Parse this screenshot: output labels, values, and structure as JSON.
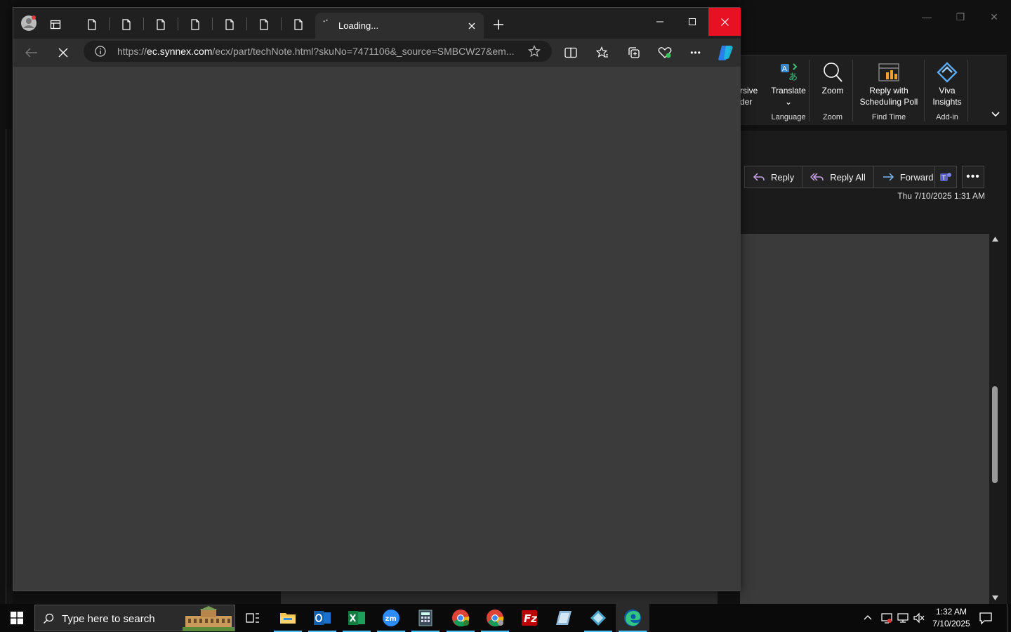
{
  "outlook": {
    "ribbon": {
      "partial_label_top": "rsive",
      "partial_label_bottom": "der",
      "translate": "Translate",
      "translate_group": "Language",
      "zoom": "Zoom",
      "zoom_group": "Zoom",
      "reply_poll_line1": "Reply with",
      "reply_poll_line2": "Scheduling Poll",
      "find_time_group": "Find Time",
      "viva_line1": "Viva",
      "viva_line2": "Insights",
      "addin_group": "Add-in"
    },
    "message": {
      "reply": "Reply",
      "reply_all": "Reply All",
      "forward": "Forward",
      "date": "Thu 7/10/2025 1:31 AM"
    }
  },
  "edge": {
    "active_tab_title": "Loading...",
    "url_prefix": "https://",
    "url_domain": "ec.synnex.com",
    "url_rest": "/ecx/part/techNote.html?skuNo=7471106&_source=SMBCW27&em..."
  },
  "taskbar": {
    "search_placeholder": "Type here to search",
    "time": "1:32 AM",
    "date": "7/10/2025"
  }
}
